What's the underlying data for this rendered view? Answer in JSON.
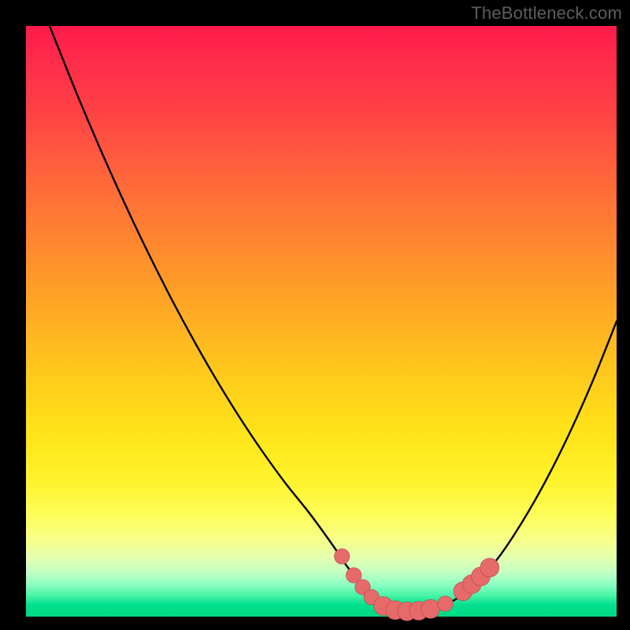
{
  "watermark": "TheBottleneck.com",
  "colors": {
    "background": "#000000",
    "curve": "#000000",
    "marker_fill": "#e66a6a",
    "marker_stroke": "#b34a4a"
  },
  "chart_data": {
    "type": "line",
    "title": "",
    "xlabel": "",
    "ylabel": "",
    "xlim": [
      0,
      100
    ],
    "ylim": [
      0,
      100
    ],
    "series": [
      {
        "name": "curve",
        "x": [
          0,
          4,
          8,
          12,
          16,
          20,
          24,
          28,
          32,
          36,
          40,
          44,
          48,
          52,
          54,
          56,
          58,
          60,
          62,
          64,
          66,
          68,
          72,
          76,
          80,
          84,
          88,
          92,
          96,
          100
        ],
        "y": [
          110,
          100,
          90,
          80.5,
          71.5,
          63,
          55,
          47.5,
          40.5,
          34,
          28,
          22.5,
          17.5,
          12,
          9,
          6.5,
          4.5,
          3,
          2,
          1.3,
          1,
          1.2,
          2.5,
          5.5,
          10,
          16,
          23,
          31,
          40,
          50
        ]
      }
    ],
    "markers": [
      {
        "x": 53.5,
        "y": 10.2,
        "r": 1.3
      },
      {
        "x": 55.5,
        "y": 7.0,
        "r": 1.3
      },
      {
        "x": 57.0,
        "y": 5.0,
        "r": 1.3
      },
      {
        "x": 58.5,
        "y": 3.3,
        "r": 1.3
      },
      {
        "x": 60.5,
        "y": 1.8,
        "r": 1.6
      },
      {
        "x": 62.5,
        "y": 1.1,
        "r": 1.6
      },
      {
        "x": 64.5,
        "y": 0.9,
        "r": 1.6
      },
      {
        "x": 66.5,
        "y": 1.0,
        "r": 1.6
      },
      {
        "x": 68.5,
        "y": 1.3,
        "r": 1.6
      },
      {
        "x": 71.0,
        "y": 2.2,
        "r": 1.3
      },
      {
        "x": 74.0,
        "y": 4.3,
        "r": 1.6
      },
      {
        "x": 75.5,
        "y": 5.5,
        "r": 1.6
      },
      {
        "x": 77.0,
        "y": 6.8,
        "r": 1.6
      },
      {
        "x": 78.5,
        "y": 8.3,
        "r": 1.6
      }
    ]
  }
}
